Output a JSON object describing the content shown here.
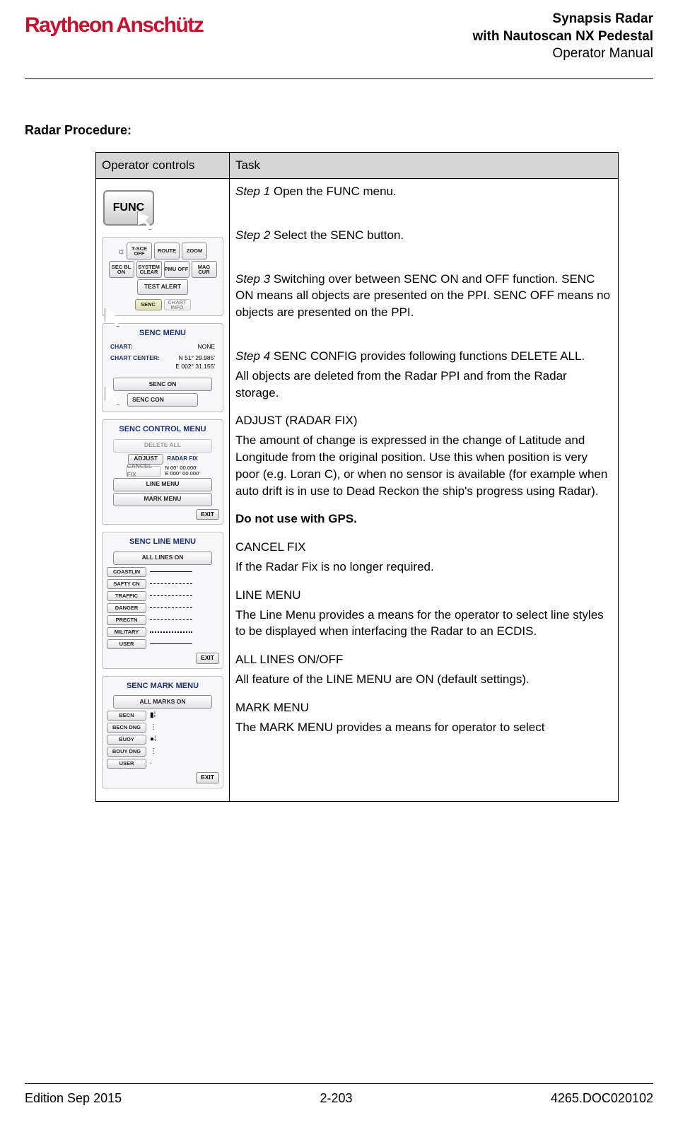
{
  "header": {
    "brand": "Raytheon",
    "subbrand": "Anschütz",
    "title1": "Synapsis Radar",
    "title2": "with Nautoscan NX Pedestal",
    "title3": "Operator Manual"
  },
  "section_title": "Radar Procedure:",
  "table": {
    "col1": "Operator controls",
    "col2": "Task"
  },
  "task": {
    "step1_label": "Step 1",
    "step1_text": " Open the FUNC menu.",
    "step2_label": "Step 2",
    "step2_text": " Select the SENC button.",
    "step3_label": "Step 3",
    "step3_text": " Switching over between SENC ON and OFF function. SENC ON means all objects are presented on the PPI. SENC OFF means no objects are presented on the PPI.",
    "step4_label": "Step 4",
    "step4_text": " SENC CONFIG provides following functions DELETE ALL.",
    "step4_cont": "All objects are deleted from the Radar PPI and from the Radar storage.",
    "adjust_title": "ADJUST (RADAR FIX)",
    "adjust_text": "The amount of change is expressed in the change of Latitude and Longitude from the original position. Use this when position is very poor (e.g. Loran C), or when no sensor is available (for example when auto drift is in use to Dead Reckon the ship's progress using Radar).",
    "gps_warning": "Do not use with GPS.",
    "cancel_title": "CANCEL FIX",
    "cancel_text": "If the Radar Fix is no longer required.",
    "line_title": "LINE MENU",
    "line_text": "The Line Menu provides a means for the operator to select line styles to be displayed when interfacing the Radar to an ECDIS.",
    "alllines_title": "ALL LINES ON/OFF",
    "alllines_text": "All feature of the LINE MENU are ON (default settings).",
    "mark_title": "MARK MENU",
    "mark_text": "The MARK MENU provides a means for operator to select"
  },
  "controls": {
    "func": "FUNC",
    "grid": {
      "r1": [
        "T-SCE OFF",
        "ROUTE",
        "ZOOM"
      ],
      "r2": [
        "SEC BL ON",
        "SYSTEM CLEAR",
        "PMU OFF",
        "MAG CUR"
      ],
      "r3": "TEST ALERT",
      "r4": [
        "SENC",
        "CHART INFO"
      ]
    },
    "senc_menu": {
      "title": "SENC MENU",
      "chart_label": "CHART:",
      "chart_value": "NONE",
      "center_label": "CHART CENTER:",
      "center_value": "N 51° 29.985'\nE 002° 31.155'",
      "senc_on": "SENC ON",
      "senc_con": "SENC CON"
    },
    "control_menu": {
      "title": "SENC CONTROL MENU",
      "delete_all": "DELETE ALL",
      "adjust": "ADJUST",
      "radar_fix": "RADAR FIX",
      "cancel_fix": "CANCEL FIX",
      "lat": "N 00° 00.000'",
      "lon": "E 000° 00.000'",
      "line_menu": "LINE MENU",
      "mark_menu": "MARK MENU",
      "exit": "EXIT"
    },
    "line_menu": {
      "title": "SENC LINE MENU",
      "all_lines": "ALL LINES ON",
      "items": [
        "COASTLIN",
        "SAFTY CN",
        "TRAFFIC",
        "DANGER",
        "PRECTN",
        "MILITARY",
        "USER"
      ],
      "exit": "EXIT"
    },
    "mark_menu": {
      "title": "SENC MARK MENU",
      "all_marks": "ALL MARKS ON",
      "items": [
        "BECN",
        "BECN DNG",
        "BUOY",
        "BOUY DNG",
        "USER"
      ],
      "exit": "EXIT"
    }
  },
  "footer": {
    "left": "Edition Sep 2015",
    "center": "2-203",
    "right": "4265.DOC020102"
  }
}
